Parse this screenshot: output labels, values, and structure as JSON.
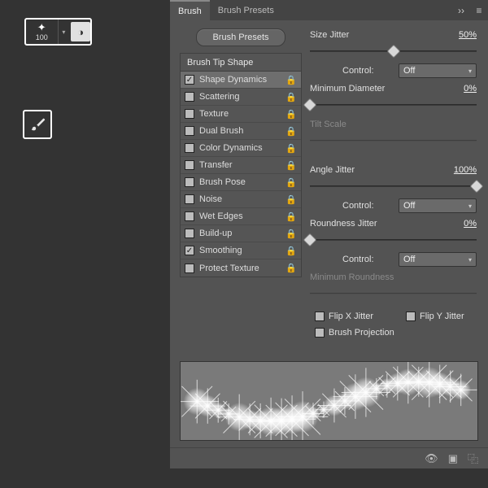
{
  "brush_widget": {
    "size": "100"
  },
  "panel": {
    "tabs": [
      {
        "label": "Brush",
        "active": true
      },
      {
        "label": "Brush Presets",
        "active": false
      }
    ],
    "brush_presets_btn": "Brush Presets",
    "brush_tip_shape": "Brush Tip Shape",
    "dynamics": [
      {
        "label": "Shape Dynamics",
        "checked": true,
        "active": true,
        "lock": true
      },
      {
        "label": "Scattering",
        "checked": false,
        "lock": true
      },
      {
        "label": "Texture",
        "checked": false,
        "lock": true
      },
      {
        "label": "Dual Brush",
        "checked": false,
        "lock": true
      },
      {
        "label": "Color Dynamics",
        "checked": false,
        "lock": true
      },
      {
        "label": "Transfer",
        "checked": false,
        "lock": true
      },
      {
        "label": "Brush Pose",
        "checked": false,
        "lock": true
      },
      {
        "label": "Noise",
        "checked": false,
        "lock": true
      },
      {
        "label": "Wet Edges",
        "checked": false,
        "lock": true
      },
      {
        "label": "Build-up",
        "checked": false,
        "lock": true
      },
      {
        "label": "Smoothing",
        "checked": true,
        "lock": true
      },
      {
        "label": "Protect Texture",
        "checked": false,
        "lock": true
      }
    ],
    "controls": {
      "size_jitter": {
        "label": "Size Jitter",
        "value": "50%",
        "percent": 50
      },
      "control_label": "Control:",
      "control_value": "Off",
      "min_diameter": {
        "label": "Minimum Diameter",
        "value": "0%",
        "percent": 0
      },
      "tilt_scale": {
        "label": "Tilt Scale"
      },
      "angle_jitter": {
        "label": "Angle Jitter",
        "value": "100%",
        "percent": 100
      },
      "roundness_jitter": {
        "label": "Roundness Jitter",
        "value": "0%",
        "percent": 0
      },
      "min_roundness": {
        "label": "Minimum Roundness"
      },
      "flip_x": "Flip X Jitter",
      "flip_y": "Flip Y Jitter",
      "brush_projection": "Brush Projection"
    }
  }
}
